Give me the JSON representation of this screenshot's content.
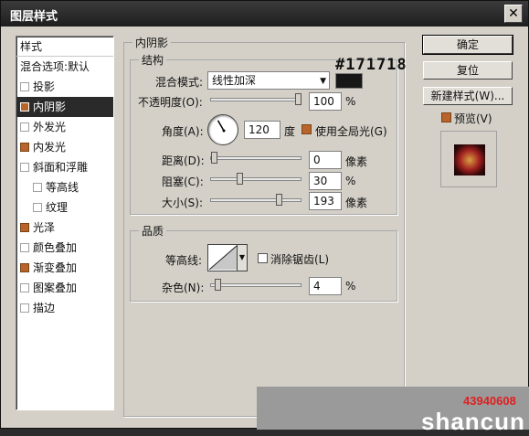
{
  "window": {
    "title": "图层样式",
    "close_glyph": "✕"
  },
  "sidebar": {
    "header": "样式",
    "items": [
      {
        "label": "混合选项:默认",
        "checkbox": false,
        "checked": false,
        "selected": false,
        "indent": false
      },
      {
        "label": "投影",
        "checkbox": true,
        "checked": false,
        "selected": false,
        "indent": false
      },
      {
        "label": "内阴影",
        "checkbox": true,
        "checked": true,
        "selected": true,
        "indent": false
      },
      {
        "label": "外发光",
        "checkbox": true,
        "checked": false,
        "selected": false,
        "indent": false
      },
      {
        "label": "内发光",
        "checkbox": true,
        "checked": true,
        "selected": false,
        "indent": false
      },
      {
        "label": "斜面和浮雕",
        "checkbox": true,
        "checked": false,
        "selected": false,
        "indent": false
      },
      {
        "label": "等高线",
        "checkbox": true,
        "checked": false,
        "selected": false,
        "indent": true
      },
      {
        "label": "纹理",
        "checkbox": true,
        "checked": false,
        "selected": false,
        "indent": true
      },
      {
        "label": "光泽",
        "checkbox": true,
        "checked": true,
        "selected": false,
        "indent": false
      },
      {
        "label": "颜色叠加",
        "checkbox": true,
        "checked": false,
        "selected": false,
        "indent": false
      },
      {
        "label": "渐变叠加",
        "checkbox": true,
        "checked": true,
        "selected": false,
        "indent": false
      },
      {
        "label": "图案叠加",
        "checkbox": true,
        "checked": false,
        "selected": false,
        "indent": false
      },
      {
        "label": "描边",
        "checkbox": true,
        "checked": false,
        "selected": false,
        "indent": false
      }
    ]
  },
  "inner_shadow": {
    "group_title": "内阴影",
    "structure": {
      "title": "结构",
      "blend_mode_label": "混合模式:",
      "blend_mode_value": "线性加深",
      "shadow_color": "#171718",
      "opacity_label": "不透明度(O):",
      "opacity_value": "100",
      "opacity_fraction": 1.0,
      "opacity_unit": "%",
      "angle_label": "角度(A):",
      "angle_value": "120",
      "angle_degrees": 120,
      "angle_unit": "度",
      "global_light_label": "使用全局光(G)",
      "global_light_checked": true,
      "distance_label": "距离(D):",
      "distance_value": "0",
      "distance_fraction": 0.0,
      "distance_unit": "像素",
      "choke_label": "阻塞(C):",
      "choke_value": "30",
      "choke_fraction": 0.3,
      "choke_unit": "%",
      "size_label": "大小(S):",
      "size_value": "193",
      "size_fraction": 0.77,
      "size_unit": "像素"
    },
    "quality": {
      "title": "品质",
      "contour_label": "等高线:",
      "antialias_label": "消除锯齿(L)",
      "antialias_checked": false,
      "noise_label": "杂色(N):",
      "noise_value": "4",
      "noise_fraction": 0.04,
      "noise_unit": "%"
    }
  },
  "buttons": {
    "ok": "确定",
    "reset": "复位",
    "new_style": "新建样式(W)...",
    "preview_label": "预览(V)",
    "preview_checked": true
  },
  "annotation": "#171718",
  "watermark": {
    "brand": "shancun",
    "number": "43940608"
  }
}
